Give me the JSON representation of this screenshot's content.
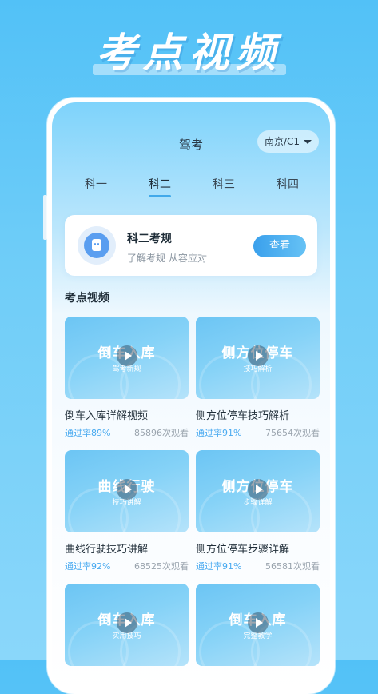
{
  "headline": "考点视频",
  "screen": {
    "title": "驾考",
    "city_selector": "南京/C1",
    "tabs": [
      {
        "label": "科一",
        "active": false
      },
      {
        "label": "科二",
        "active": true
      },
      {
        "label": "科三",
        "active": false
      },
      {
        "label": "科四",
        "active": false
      }
    ],
    "card": {
      "title": "科二考规",
      "subtitle": "了解考规 从容应对",
      "button": "查看"
    },
    "section_title": "考点视频",
    "videos": [
      {
        "thumb_title": "倒车入库",
        "thumb_sub": "驾考新规",
        "title": "倒车入库详解视频",
        "rate": "通过率89%",
        "views": "85896次观看"
      },
      {
        "thumb_title": "侧方位停车",
        "thumb_sub": "技巧解析",
        "title": "侧方位停车技巧解析",
        "rate": "通过率91%",
        "views": "75654次观看"
      },
      {
        "thumb_title": "曲线行驶",
        "thumb_sub": "技巧讲解",
        "title": "曲线行驶技巧讲解",
        "rate": "通过率92%",
        "views": "68525次观看"
      },
      {
        "thumb_title": "侧方位停车",
        "thumb_sub": "步骤详解",
        "title": "侧方位停车步骤详解",
        "rate": "通过率91%",
        "views": "56581次观看"
      },
      {
        "thumb_title": "倒车入库",
        "thumb_sub": "实用技巧",
        "title": "",
        "rate": "",
        "views": ""
      },
      {
        "thumb_title": "倒车入库",
        "thumb_sub": "完整教学",
        "title": "",
        "rate": "",
        "views": ""
      }
    ]
  },
  "colors": {
    "accent": "#42a9ea",
    "rate": "#49aaf0",
    "background": "#5ec6f8"
  }
}
